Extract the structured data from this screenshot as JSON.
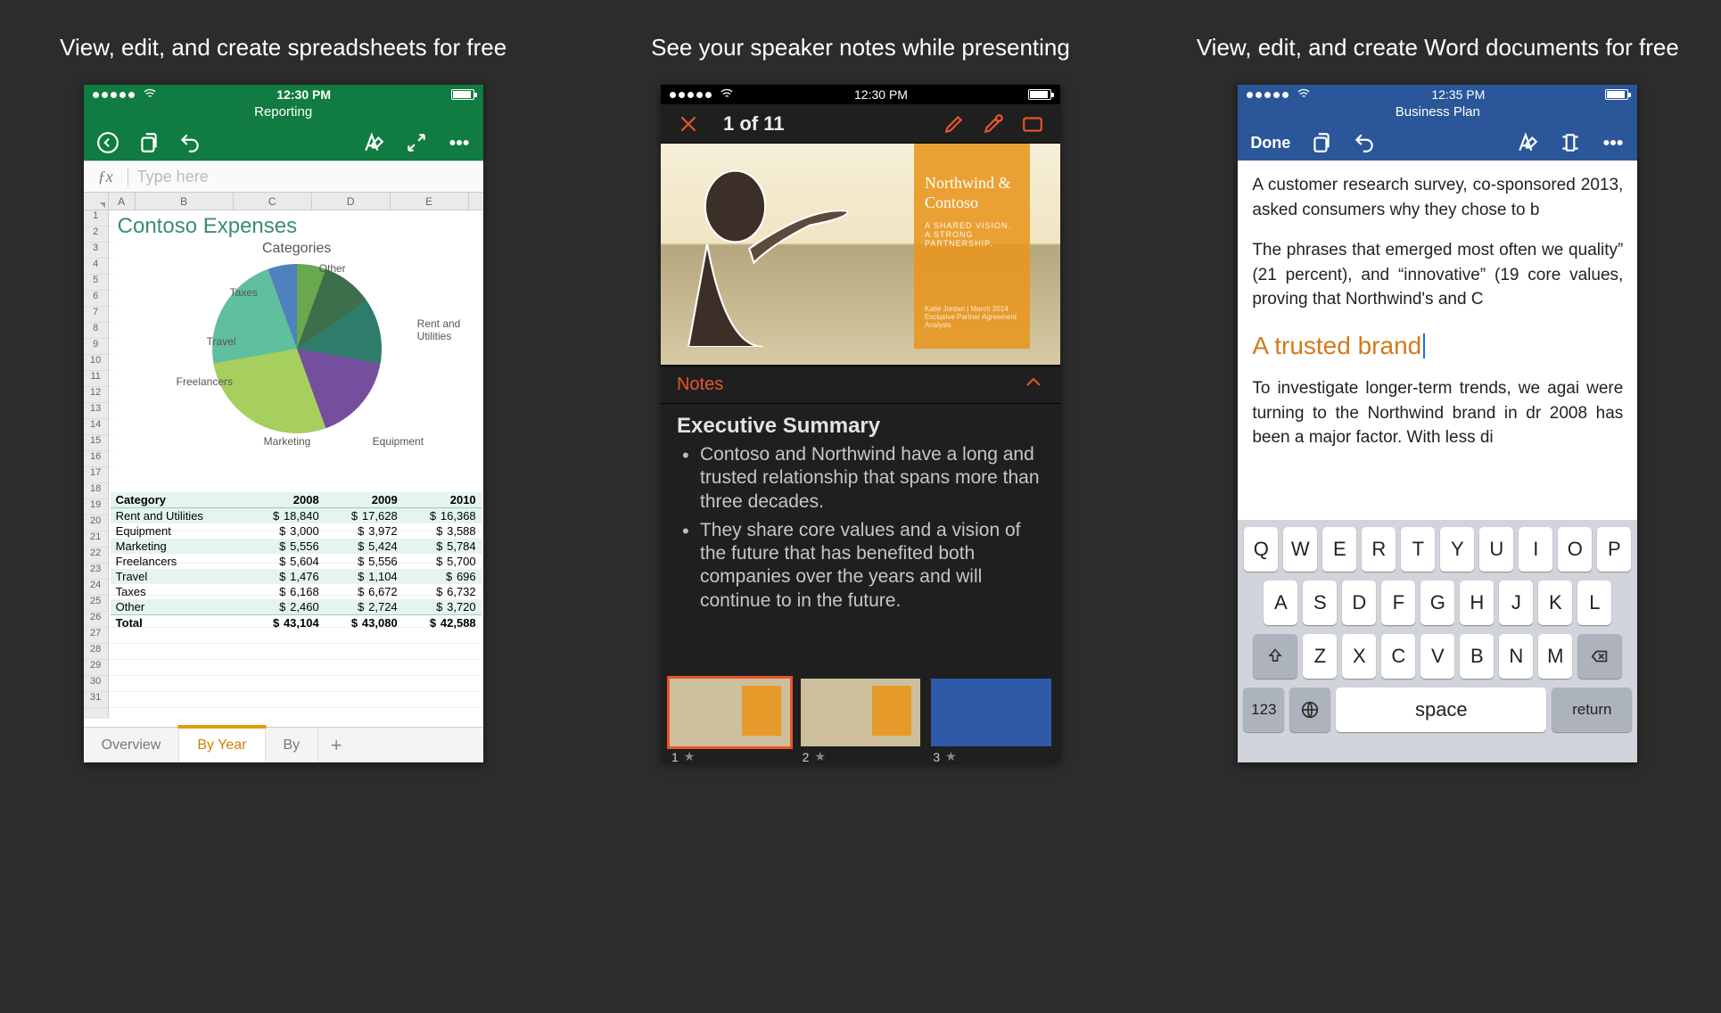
{
  "captions": {
    "excel": "View, edit, and create spreadsheets for free",
    "ppt": "See your speaker notes while presenting",
    "word": "View, edit, and create Word documents for free"
  },
  "excel": {
    "time": "12:30 PM",
    "doc_title": "Reporting",
    "fx_placeholder": "Type here",
    "columns": [
      "A",
      "B",
      "C",
      "D",
      "E"
    ],
    "chart_title": "Contoso Expenses",
    "chart_subtitle": "Categories",
    "table_headers": [
      "Category",
      "2008",
      "2009",
      "2010"
    ],
    "rows": [
      {
        "cat": "Rent and Utilities",
        "v": [
          "18,840",
          "17,628",
          "16,368"
        ]
      },
      {
        "cat": "Equipment",
        "v": [
          "3,000",
          "3,972",
          "3,588"
        ]
      },
      {
        "cat": "Marketing",
        "v": [
          "5,556",
          "5,424",
          "5,784"
        ]
      },
      {
        "cat": "Freelancers",
        "v": [
          "5,604",
          "5,556",
          "5,700"
        ]
      },
      {
        "cat": "Travel",
        "v": [
          "1,476",
          "1,104",
          "696"
        ]
      },
      {
        "cat": "Taxes",
        "v": [
          "6,168",
          "6,672",
          "6,732"
        ]
      },
      {
        "cat": "Other",
        "v": [
          "2,460",
          "2,724",
          "3,720"
        ]
      }
    ],
    "total": {
      "cat": "Total",
      "v": [
        "43,104",
        "43,080",
        "42,588"
      ]
    },
    "tabs": [
      "Overview",
      "By Year",
      "By"
    ],
    "active_tab": 1,
    "pie_labels": [
      "Other",
      "Taxes",
      "Travel",
      "Freelancers",
      "Marketing",
      "Equipment",
      "Rent and Utilities"
    ]
  },
  "ppt": {
    "time": "12:30 PM",
    "counter": "1 of 11",
    "notes_label": "Notes",
    "notes_heading": "Executive Summary",
    "bullets": [
      "Contoso and Northwind have a long and trusted relationship that spans more than three decades.",
      "They share core values and a vision of the future that has benefited both companies over the years and will continue to in the future."
    ],
    "slide": {
      "line1": "Northwind &",
      "line2": "Contoso",
      "tag1": "A SHARED VISION.",
      "tag2": "A STRONG PARTNERSHIP.",
      "footer": "Katie Jordan | March 2014\nExclusive Partner Agreement Analysis"
    },
    "thumbs": [
      "1",
      "2",
      "3"
    ]
  },
  "word": {
    "time": "12:35 PM",
    "doc_title": "Business Plan",
    "done": "Done",
    "para1": "A customer research survey, co-sponsored 2013, asked consumers why they chose to b",
    "para2": "The phrases that emerged most often we quality” (21 percent), and “innovative” (19 core values, proving that Northwind's and C",
    "heading": "A trusted brand",
    "para3": "To investigate longer-term trends, we agai were turning to the Northwind brand in dr 2008 has been a major factor. With less di",
    "keyboard": {
      "r1": [
        "Q",
        "W",
        "E",
        "R",
        "T",
        "Y",
        "U",
        "I",
        "O",
        "P"
      ],
      "r2": [
        "A",
        "S",
        "D",
        "F",
        "G",
        "H",
        "J",
        "K",
        "L"
      ],
      "r3": [
        "Z",
        "X",
        "C",
        "V",
        "B",
        "N",
        "M"
      ],
      "sym": "123",
      "space": "space",
      "ret": "return"
    }
  },
  "chart_data": {
    "type": "pie",
    "title": "Contoso Expenses — Categories",
    "series": [
      {
        "name": "2008",
        "categories": [
          "Rent and Utilities",
          "Equipment",
          "Marketing",
          "Freelancers",
          "Travel",
          "Taxes",
          "Other"
        ],
        "values": [
          18840,
          3000,
          5556,
          5604,
          1476,
          6168,
          2460
        ]
      }
    ]
  }
}
